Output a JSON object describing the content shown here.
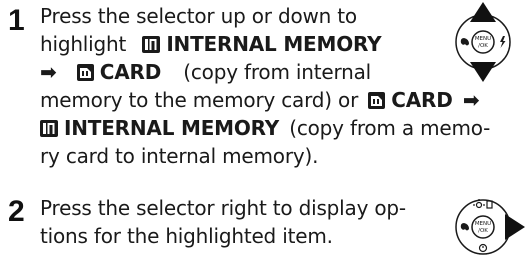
{
  "step1": {
    "number": "1",
    "line1": "Press the selector up or down to",
    "line2_pre": "highlight",
    "internal_memory": "INTERNAL MEMORY",
    "arrow": "➡",
    "card": "CARD",
    "line3_tail": "(copy from internal",
    "line4_pre": "memory to the memory card) or",
    "line5_tail": "(copy from a memo-",
    "line6": "ry card to internal memory)."
  },
  "step2": {
    "number": "2",
    "line1": "Press the selector right to display op-",
    "line2": "tions for the highlighted item."
  },
  "dial": {
    "center_label_top": "MENU",
    "center_label_bottom": "/OK"
  },
  "icons": [
    "internal-memory-icon",
    "sd-card-icon",
    "selector-dial-icon"
  ]
}
